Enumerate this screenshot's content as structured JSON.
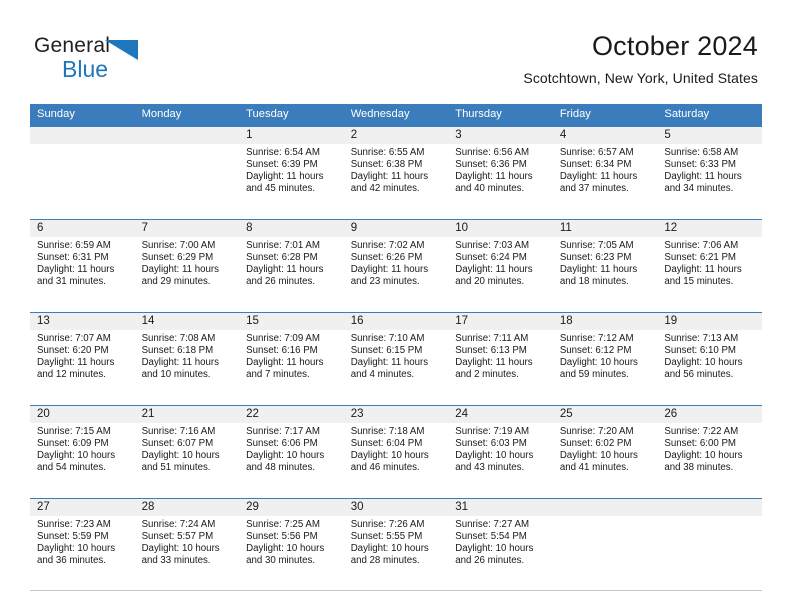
{
  "logo": {
    "word_top": "General",
    "word_bottom": "Blue",
    "triangle_icon": "triangle-icon",
    "brand_color": "#1e77bc"
  },
  "header": {
    "title": "October 2024",
    "subtitle": "Scotchtown, New York, United States"
  },
  "colors": {
    "header_blue": "#3b7dbc",
    "date_band": "#f0f0f0",
    "text": "#1a1a1a"
  },
  "weekdays": [
    "Sunday",
    "Monday",
    "Tuesday",
    "Wednesday",
    "Thursday",
    "Friday",
    "Saturday"
  ],
  "weeks": [
    [
      {
        "day": "",
        "sunrise": "",
        "sunset": "",
        "daylight_line1": "",
        "daylight_line2": ""
      },
      {
        "day": "",
        "sunrise": "",
        "sunset": "",
        "daylight_line1": "",
        "daylight_line2": ""
      },
      {
        "day": "1",
        "sunrise": "Sunrise: 6:54 AM",
        "sunset": "Sunset: 6:39 PM",
        "daylight_line1": "Daylight: 11 hours",
        "daylight_line2": "and 45 minutes."
      },
      {
        "day": "2",
        "sunrise": "Sunrise: 6:55 AM",
        "sunset": "Sunset: 6:38 PM",
        "daylight_line1": "Daylight: 11 hours",
        "daylight_line2": "and 42 minutes."
      },
      {
        "day": "3",
        "sunrise": "Sunrise: 6:56 AM",
        "sunset": "Sunset: 6:36 PM",
        "daylight_line1": "Daylight: 11 hours",
        "daylight_line2": "and 40 minutes."
      },
      {
        "day": "4",
        "sunrise": "Sunrise: 6:57 AM",
        "sunset": "Sunset: 6:34 PM",
        "daylight_line1": "Daylight: 11 hours",
        "daylight_line2": "and 37 minutes."
      },
      {
        "day": "5",
        "sunrise": "Sunrise: 6:58 AM",
        "sunset": "Sunset: 6:33 PM",
        "daylight_line1": "Daylight: 11 hours",
        "daylight_line2": "and 34 minutes."
      }
    ],
    [
      {
        "day": "6",
        "sunrise": "Sunrise: 6:59 AM",
        "sunset": "Sunset: 6:31 PM",
        "daylight_line1": "Daylight: 11 hours",
        "daylight_line2": "and 31 minutes."
      },
      {
        "day": "7",
        "sunrise": "Sunrise: 7:00 AM",
        "sunset": "Sunset: 6:29 PM",
        "daylight_line1": "Daylight: 11 hours",
        "daylight_line2": "and 29 minutes."
      },
      {
        "day": "8",
        "sunrise": "Sunrise: 7:01 AM",
        "sunset": "Sunset: 6:28 PM",
        "daylight_line1": "Daylight: 11 hours",
        "daylight_line2": "and 26 minutes."
      },
      {
        "day": "9",
        "sunrise": "Sunrise: 7:02 AM",
        "sunset": "Sunset: 6:26 PM",
        "daylight_line1": "Daylight: 11 hours",
        "daylight_line2": "and 23 minutes."
      },
      {
        "day": "10",
        "sunrise": "Sunrise: 7:03 AM",
        "sunset": "Sunset: 6:24 PM",
        "daylight_line1": "Daylight: 11 hours",
        "daylight_line2": "and 20 minutes."
      },
      {
        "day": "11",
        "sunrise": "Sunrise: 7:05 AM",
        "sunset": "Sunset: 6:23 PM",
        "daylight_line1": "Daylight: 11 hours",
        "daylight_line2": "and 18 minutes."
      },
      {
        "day": "12",
        "sunrise": "Sunrise: 7:06 AM",
        "sunset": "Sunset: 6:21 PM",
        "daylight_line1": "Daylight: 11 hours",
        "daylight_line2": "and 15 minutes."
      }
    ],
    [
      {
        "day": "13",
        "sunrise": "Sunrise: 7:07 AM",
        "sunset": "Sunset: 6:20 PM",
        "daylight_line1": "Daylight: 11 hours",
        "daylight_line2": "and 12 minutes."
      },
      {
        "day": "14",
        "sunrise": "Sunrise: 7:08 AM",
        "sunset": "Sunset: 6:18 PM",
        "daylight_line1": "Daylight: 11 hours",
        "daylight_line2": "and 10 minutes."
      },
      {
        "day": "15",
        "sunrise": "Sunrise: 7:09 AM",
        "sunset": "Sunset: 6:16 PM",
        "daylight_line1": "Daylight: 11 hours",
        "daylight_line2": "and 7 minutes."
      },
      {
        "day": "16",
        "sunrise": "Sunrise: 7:10 AM",
        "sunset": "Sunset: 6:15 PM",
        "daylight_line1": "Daylight: 11 hours",
        "daylight_line2": "and 4 minutes."
      },
      {
        "day": "17",
        "sunrise": "Sunrise: 7:11 AM",
        "sunset": "Sunset: 6:13 PM",
        "daylight_line1": "Daylight: 11 hours",
        "daylight_line2": "and 2 minutes."
      },
      {
        "day": "18",
        "sunrise": "Sunrise: 7:12 AM",
        "sunset": "Sunset: 6:12 PM",
        "daylight_line1": "Daylight: 10 hours",
        "daylight_line2": "and 59 minutes."
      },
      {
        "day": "19",
        "sunrise": "Sunrise: 7:13 AM",
        "sunset": "Sunset: 6:10 PM",
        "daylight_line1": "Daylight: 10 hours",
        "daylight_line2": "and 56 minutes."
      }
    ],
    [
      {
        "day": "20",
        "sunrise": "Sunrise: 7:15 AM",
        "sunset": "Sunset: 6:09 PM",
        "daylight_line1": "Daylight: 10 hours",
        "daylight_line2": "and 54 minutes."
      },
      {
        "day": "21",
        "sunrise": "Sunrise: 7:16 AM",
        "sunset": "Sunset: 6:07 PM",
        "daylight_line1": "Daylight: 10 hours",
        "daylight_line2": "and 51 minutes."
      },
      {
        "day": "22",
        "sunrise": "Sunrise: 7:17 AM",
        "sunset": "Sunset: 6:06 PM",
        "daylight_line1": "Daylight: 10 hours",
        "daylight_line2": "and 48 minutes."
      },
      {
        "day": "23",
        "sunrise": "Sunrise: 7:18 AM",
        "sunset": "Sunset: 6:04 PM",
        "daylight_line1": "Daylight: 10 hours",
        "daylight_line2": "and 46 minutes."
      },
      {
        "day": "24",
        "sunrise": "Sunrise: 7:19 AM",
        "sunset": "Sunset: 6:03 PM",
        "daylight_line1": "Daylight: 10 hours",
        "daylight_line2": "and 43 minutes."
      },
      {
        "day": "25",
        "sunrise": "Sunrise: 7:20 AM",
        "sunset": "Sunset: 6:02 PM",
        "daylight_line1": "Daylight: 10 hours",
        "daylight_line2": "and 41 minutes."
      },
      {
        "day": "26",
        "sunrise": "Sunrise: 7:22 AM",
        "sunset": "Sunset: 6:00 PM",
        "daylight_line1": "Daylight: 10 hours",
        "daylight_line2": "and 38 minutes."
      }
    ],
    [
      {
        "day": "27",
        "sunrise": "Sunrise: 7:23 AM",
        "sunset": "Sunset: 5:59 PM",
        "daylight_line1": "Daylight: 10 hours",
        "daylight_line2": "and 36 minutes."
      },
      {
        "day": "28",
        "sunrise": "Sunrise: 7:24 AM",
        "sunset": "Sunset: 5:57 PM",
        "daylight_line1": "Daylight: 10 hours",
        "daylight_line2": "and 33 minutes."
      },
      {
        "day": "29",
        "sunrise": "Sunrise: 7:25 AM",
        "sunset": "Sunset: 5:56 PM",
        "daylight_line1": "Daylight: 10 hours",
        "daylight_line2": "and 30 minutes."
      },
      {
        "day": "30",
        "sunrise": "Sunrise: 7:26 AM",
        "sunset": "Sunset: 5:55 PM",
        "daylight_line1": "Daylight: 10 hours",
        "daylight_line2": "and 28 minutes."
      },
      {
        "day": "31",
        "sunrise": "Sunrise: 7:27 AM",
        "sunset": "Sunset: 5:54 PM",
        "daylight_line1": "Daylight: 10 hours",
        "daylight_line2": "and 26 minutes."
      },
      {
        "day": "",
        "sunrise": "",
        "sunset": "",
        "daylight_line1": "",
        "daylight_line2": ""
      },
      {
        "day": "",
        "sunrise": "",
        "sunset": "",
        "daylight_line1": "",
        "daylight_line2": ""
      }
    ]
  ]
}
